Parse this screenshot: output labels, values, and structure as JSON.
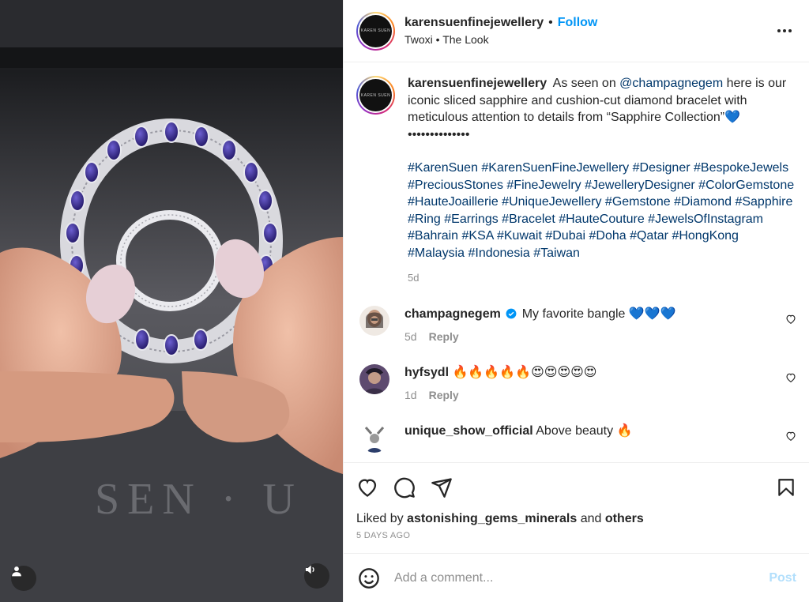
{
  "post": {
    "username": "karensuenfinejewellery",
    "follow_label": "Follow",
    "subtitle": "Twoxi • The Look",
    "logo_text": "KAREN SUEN"
  },
  "caption": {
    "username": "karensuenfinejewellery",
    "text_before_mention": "As seen on",
    "mention": "@champagnegem",
    "text_after_mention": "here is our iconic sliced sapphire and cushion-cut diamond bracelet with meticulous attention to details from “Sapphire Collection”💙",
    "dots": "••••••••••••••",
    "hashtags": "#KarenSuen #KarenSuenFineJewellery #Designer #BespokeJewels #PreciousStones #FineJewelry #JewelleryDesigner #ColorGemstone #HauteJoaillerie #UniqueJewellery #Gemstone #Diamond #Sapphire #Ring #Earrings #Bracelet #HauteCouture #JewelsOfInstagram #Bahrain #KSA #Kuwait #Dubai #Doha #Qatar #HongKong #Malaysia #Indonesia #Taiwan",
    "ago": "5d"
  },
  "comments": [
    {
      "username": "champagnegem",
      "text": "My favorite bangle 💙💙💙",
      "ago": "5d",
      "reply": "Reply",
      "verified": true
    },
    {
      "username": "hyfsydl",
      "text": "🔥🔥🔥🔥🔥😍😍😍😍😍",
      "ago": "1d",
      "reply": "Reply",
      "verified": false
    },
    {
      "username": "unique_show_official",
      "text": "Above beauty 🔥",
      "ago": "",
      "reply": "",
      "verified": false
    }
  ],
  "liked_by": {
    "prefix": "Liked by",
    "user": "astonishing_gems_minerals",
    "and": "and",
    "others": "others"
  },
  "timestamp": "5 DAYS AGO",
  "add_comment": {
    "placeholder": "Add a comment...",
    "post_label": "Post"
  },
  "colors": {
    "accent": "#0095f6",
    "hashtag": "#00376b",
    "muted": "#8e8e8e",
    "post_disabled": "#b2dffc"
  },
  "icons": [
    "user-tag-icon",
    "speaker-icon",
    "more-options-icon",
    "heart-icon",
    "comment-icon",
    "share-icon",
    "bookmark-icon",
    "emoji-icon",
    "verified-icon"
  ]
}
